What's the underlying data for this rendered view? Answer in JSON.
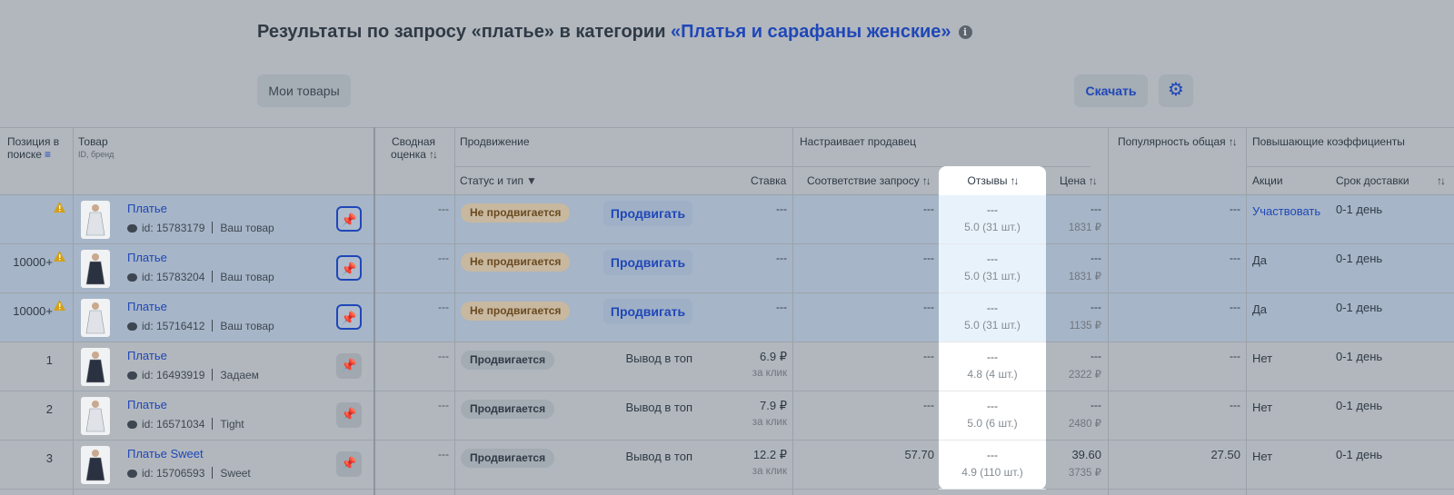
{
  "header": {
    "title_prefix": "Результаты по запросу «платье» в категории ",
    "title_category": "«Платья и сарафаны женские»",
    "info_icon": "i"
  },
  "toolbar": {
    "my_products_label": "Мои товары",
    "download_label": "Скачать",
    "settings_icon": "gear-icon"
  },
  "columns": {
    "position": "Позиция в поиске",
    "product": "Товар",
    "product_sub": "ID, бренд",
    "rating": "Сводная оценка",
    "promotion": "Продвижение",
    "status_type": "Статус и тип",
    "bid": "Ставка",
    "seller_settings": "Настраивает продавец",
    "relevance": "Соответствие запросу",
    "reviews": "Отзывы",
    "price": "Цена",
    "popularity": "Популярность общая",
    "boost": "Повышающие коэффициенты",
    "promos": "Акции",
    "delivery": "Срок доставки"
  },
  "rows": [
    {
      "position": "",
      "warn": true,
      "name": "Платье",
      "id": "id: 15783179",
      "brand": "Ваш товар",
      "pinned": true,
      "rating": "---",
      "status": "Не продвигается",
      "promoted": false,
      "action": "Продвигать",
      "bid": "---",
      "bid_unit": "",
      "relevance": "---",
      "reviews_top": "---",
      "reviews": "5.0 (31 шт.)",
      "price_top": "---",
      "price": "1831 ₽",
      "popularity": "---",
      "promos": "Участвовать",
      "promos_link": true,
      "delivery": "0-1 день"
    },
    {
      "position": "10000+",
      "warn": true,
      "name": "Платье",
      "id": "id: 15783204",
      "brand": "Ваш товар",
      "pinned": true,
      "rating": "---",
      "status": "Не продвигается",
      "promoted": false,
      "action": "Продвигать",
      "bid": "---",
      "bid_unit": "",
      "relevance": "---",
      "reviews_top": "---",
      "reviews": "5.0 (31 шт.)",
      "price_top": "---",
      "price": "1831 ₽",
      "popularity": "---",
      "promos": "Да",
      "promos_link": false,
      "delivery": "0-1 день"
    },
    {
      "position": "10000+",
      "warn": true,
      "name": "Платье",
      "id": "id: 15716412",
      "brand": "Ваш товар",
      "pinned": true,
      "rating": "---",
      "status": "Не продвигается",
      "promoted": false,
      "action": "Продвигать",
      "bid": "---",
      "bid_unit": "",
      "relevance": "---",
      "reviews_top": "---",
      "reviews": "5.0 (31 шт.)",
      "price_top": "---",
      "price": "1135 ₽",
      "popularity": "---",
      "promos": "Да",
      "promos_link": false,
      "delivery": "0-1 день"
    },
    {
      "position": "1",
      "warn": false,
      "name": "Платье",
      "id": "id: 16493919",
      "brand": "Задаем",
      "pinned": false,
      "rating": "---",
      "status": "Продвигается",
      "promoted": true,
      "action": "Вывод в топ",
      "bid": "6.9 ₽",
      "bid_unit": "за клик",
      "relevance": "---",
      "reviews_top": "---",
      "reviews": "4.8 (4 шт.)",
      "price_top": "---",
      "price": "2322 ₽",
      "popularity": "---",
      "promos": "Нет",
      "promos_link": false,
      "delivery": "0-1 день"
    },
    {
      "position": "2",
      "warn": false,
      "name": "Платье",
      "id": "id: 16571034",
      "brand": "Tight",
      "pinned": false,
      "rating": "---",
      "status": "Продвигается",
      "promoted": true,
      "action": "Вывод в топ",
      "bid": "7.9 ₽",
      "bid_unit": "за клик",
      "relevance": "---",
      "reviews_top": "---",
      "reviews": "5.0 (6 шт.)",
      "price_top": "---",
      "price": "2480 ₽",
      "popularity": "---",
      "promos": "Нет",
      "promos_link": false,
      "delivery": "0-1 день"
    },
    {
      "position": "3",
      "warn": false,
      "name": "Платье Sweet",
      "id": "id: 15706593",
      "brand": "Sweet",
      "pinned": false,
      "rating": "---",
      "status": "Продвигается",
      "promoted": true,
      "action": "Вывод в топ",
      "bid": "12.2 ₽",
      "bid_unit": "за клик",
      "relevance": "57.70",
      "reviews_top": "---",
      "reviews": "4.9 (110 шт.)",
      "price_top": "39.60",
      "price": "3735 ₽",
      "popularity": "27.50",
      "promos": "Нет",
      "promos_link": false,
      "delivery": "0-1 день"
    }
  ],
  "colors": {
    "accent": "#1f47b8",
    "overlay": "#b2b7bd",
    "highlight_row": "#a6b5c7",
    "warning": "#d4a017"
  }
}
